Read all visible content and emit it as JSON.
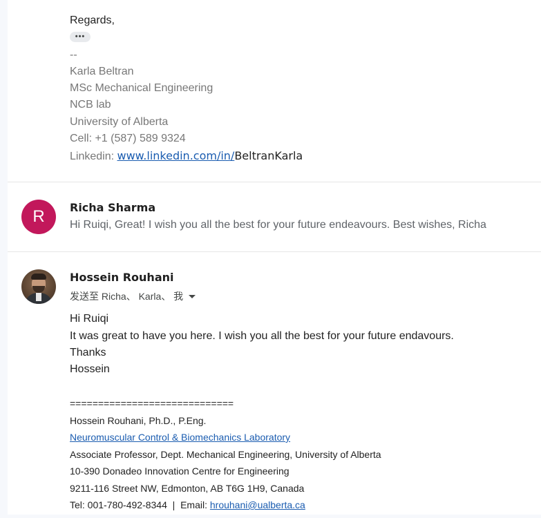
{
  "message_prev": {
    "regards": "Regards,",
    "trimmed_content_label": "•••",
    "signature": {
      "dash": "--",
      "name": "Karla Beltran",
      "degree": "MSc Mechanical Engineering",
      "lab": "NCB lab",
      "university": "University of Alberta",
      "cell": "Cell: +1 (587) 589 9324",
      "linkedin_label": "Linkedin: ",
      "linkedin_link": "www.linkedin.com/in/",
      "linkedin_tail": "BeltranKarla"
    }
  },
  "message_collapsed": {
    "avatar_letter": "R",
    "avatar_color": "#c2185b",
    "sender": "Richa Sharma",
    "snippet": "Hi Ruiqi, Great! I wish you all the best for your future endeavours. Best wishes, Richa"
  },
  "message_open": {
    "sender": "Hossein Rouhani",
    "recipients": "发送至 Richa、 Karla、 我",
    "body": {
      "line1": "Hi Ruiqi",
      "line2": "It was great to have you here. I wish you all the best for your future endavours.",
      "line3": "Thanks",
      "line4": "Hossein"
    },
    "signature": {
      "separator": "=============================",
      "name": "Hossein Rouhani, Ph.D., P.Eng.",
      "lab_link": "Neuromuscular Control & Biomechanics Laboratory",
      "position": "Associate Professor, Dept. Mechanical Engineering, University of Alberta",
      "office": "10-390 Donadeo Innovation Centre for Engineering",
      "address": "9211-116 Street NW, Edmonton, AB T6G 1H9, Canada",
      "tel_prefix": "Tel: 001-780-492-8344  |  Email: ",
      "email": "hrouhani@ualberta.ca"
    }
  },
  "colors": {
    "link": "#1a5cb0",
    "page_bg": "#f6f8fc"
  }
}
